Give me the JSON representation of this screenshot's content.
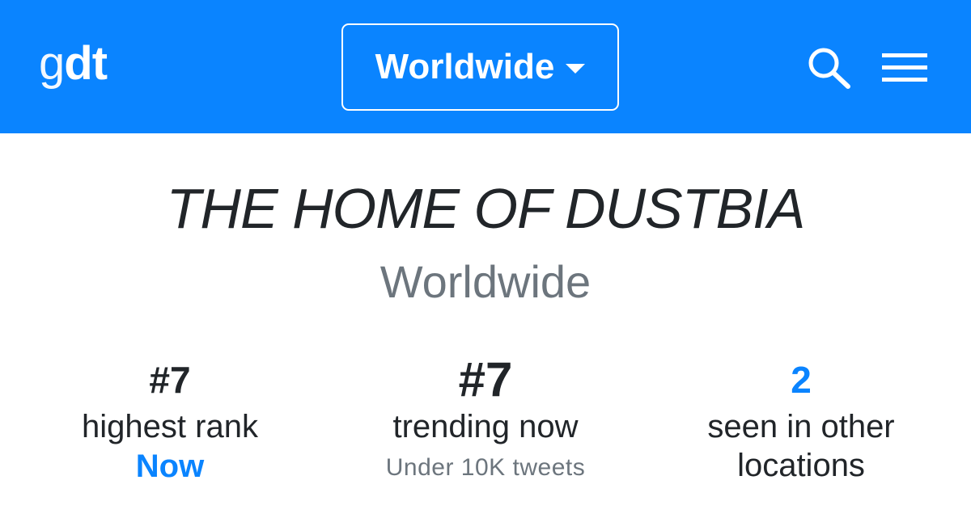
{
  "navbar": {
    "brand_light": "g",
    "brand_bold": "dt",
    "location_button": "Worldwide",
    "background_color": "#0a84ff",
    "icons": [
      "search-icon",
      "hamburger-menu-icon",
      "chevron-down-icon"
    ]
  },
  "trend": {
    "title": "THE HOME OF DUSTBIA",
    "location": "Worldwide"
  },
  "stats": [
    {
      "value": "#7",
      "label": "highest rank",
      "extra": "Now"
    },
    {
      "value": "#7",
      "label": "trending now",
      "note": "Under 10K tweets"
    },
    {
      "value": "2",
      "label_line1": "seen in other",
      "label_line2": "locations"
    }
  ],
  "colors": {
    "accent": "#0a84ff",
    "muted": "#6c757d",
    "text": "#212529"
  }
}
